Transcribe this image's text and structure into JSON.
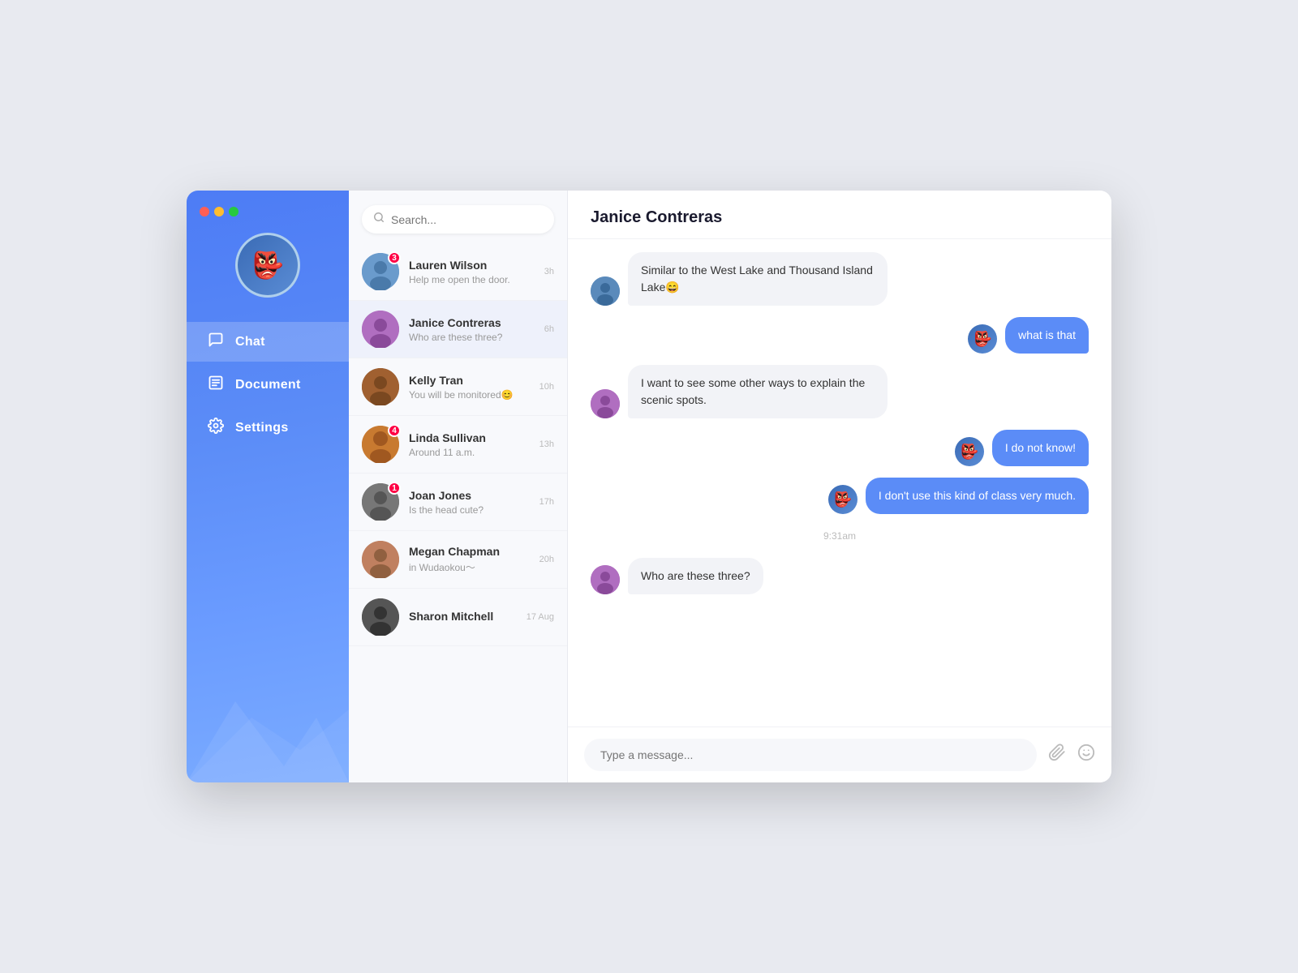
{
  "window": {
    "traffic_lights": [
      "red",
      "yellow",
      "green"
    ]
  },
  "sidebar": {
    "user_avatar_emoji": "👺",
    "nav_items": [
      {
        "id": "chat",
        "label": "Chat",
        "icon": "💬",
        "active": true
      },
      {
        "id": "document",
        "label": "Document",
        "icon": "🗂",
        "active": false
      },
      {
        "id": "settings",
        "label": "Settings",
        "icon": "⚙️",
        "active": false
      }
    ]
  },
  "contact_list": {
    "search_placeholder": "Search...",
    "contacts": [
      {
        "id": 1,
        "name": "Lauren Wilson",
        "preview": "Help me open the door.",
        "time": "3h",
        "badge": 3,
        "avatar_color": "av-blue"
      },
      {
        "id": 2,
        "name": "Janice Contreras",
        "preview": "Who are these three?",
        "time": "6h",
        "badge": 0,
        "avatar_color": "av-purple",
        "active": true
      },
      {
        "id": 3,
        "name": "Kelly Tran",
        "preview": "You will be monitored😊",
        "time": "10h",
        "badge": 0,
        "avatar_color": "av-brown"
      },
      {
        "id": 4,
        "name": "Linda Sullivan",
        "preview": "Around 11 a.m.",
        "time": "13h",
        "badge": 4,
        "avatar_color": "av-teal"
      },
      {
        "id": 5,
        "name": "Joan Jones",
        "preview": "Is the head cute?",
        "time": "17h",
        "badge": 1,
        "avatar_color": "av-gray"
      },
      {
        "id": 6,
        "name": "Megan Chapman",
        "preview": "in Wudaokou～",
        "time": "20h",
        "badge": 0,
        "avatar_color": "av-peach"
      },
      {
        "id": 7,
        "name": "Sharon Mitchell",
        "preview": "",
        "time": "17 Aug",
        "badge": 0,
        "avatar_color": "av-dark"
      }
    ]
  },
  "chat": {
    "contact_name": "Janice Contreras",
    "messages": [
      {
        "id": 1,
        "type": "incoming",
        "text": "Similar to the West Lake and Thousand Island Lake😄",
        "avatar_color": "av-blue"
      },
      {
        "id": 2,
        "type": "outgoing",
        "text": "what is that",
        "avatar_color": "av-mask"
      },
      {
        "id": 3,
        "type": "incoming",
        "text": "I want to see some other ways to explain the scenic spots.",
        "avatar_color": "av-purple"
      },
      {
        "id": 4,
        "type": "outgoing",
        "text": "I do not know!",
        "avatar_color": "av-mask"
      },
      {
        "id": 5,
        "type": "outgoing",
        "text": "I don't use this kind of class very much.",
        "avatar_color": "av-mask"
      },
      {
        "id": 6,
        "type": "time_divider",
        "text": "9:31am"
      },
      {
        "id": 7,
        "type": "incoming",
        "text": "Who are these three?",
        "avatar_color": "av-purple"
      }
    ],
    "input_placeholder": "Type a message..."
  }
}
